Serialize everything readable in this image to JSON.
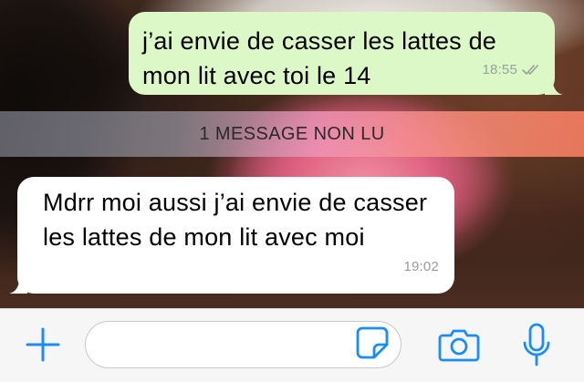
{
  "chat": {
    "messages": [
      {
        "direction": "outgoing",
        "text": "j’ai envie de casser les lattes de mon lit avec toi le 14",
        "time": "18:55",
        "status_icon": "double-check-icon"
      },
      {
        "direction": "incoming",
        "text": "Mdrr moi aussi j’ai envie de casser les lattes de mon lit avec moi",
        "time": "19:02"
      }
    ],
    "unread_divider": "1 MESSAGE NON LU"
  },
  "composer": {
    "input_value": "",
    "input_placeholder": "",
    "icons": {
      "attach": "plus-icon",
      "sticker": "sticker-icon",
      "camera": "camera-icon",
      "mic": "microphone-icon"
    }
  },
  "colors": {
    "outgoing_bubble": "#dcf8c6",
    "incoming_bubble": "#ffffff",
    "accent": "#1a8cff",
    "timestamp": "#9aa19a"
  }
}
